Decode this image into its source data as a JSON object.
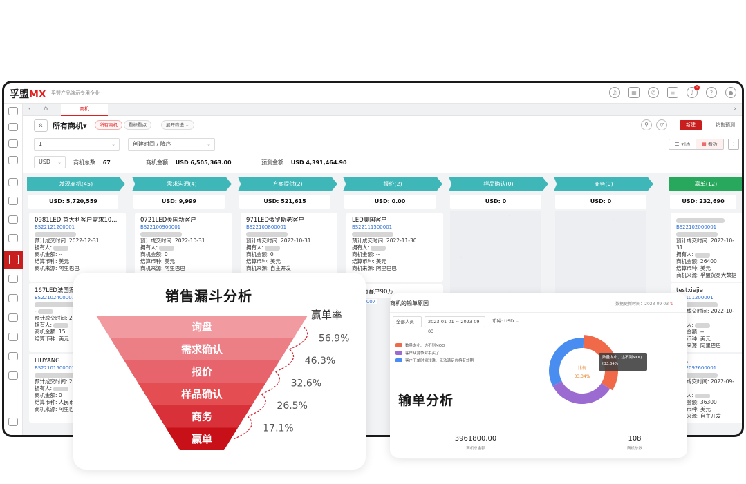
{
  "app": {
    "logo_text": "孚盟",
    "logo_mx": "MX",
    "subtitle": "孚盟产品演示专用企业",
    "tab_active": "商机"
  },
  "filters": {
    "title": "所有商机",
    "chips": [
      "所有商机",
      "重标重点"
    ],
    "expand_label": "展开筛选",
    "new_button": "新建",
    "forecast_button": "销售预测",
    "page_input": "1",
    "sort_select": "创建时间 / 降序",
    "currency_select": "USD",
    "view_list": "列表",
    "view_board": "看板",
    "summary": {
      "count_label": "商机总数:",
      "count_value": "67",
      "amount_label": "商机金额:",
      "amount_value": "USD 6,505,363.00",
      "forecast_label": "预测金额:",
      "forecast_value": "USD 4,391,464.90"
    }
  },
  "stages": [
    {
      "label": "发现商机(45)",
      "total": "USD: 5,720,559"
    },
    {
      "label": "需求沟通(4)",
      "total": "USD: 9,999"
    },
    {
      "label": "方案提供(2)",
      "total": "USD: 521,615"
    },
    {
      "label": "报价(2)",
      "total": "USD: 0.00"
    },
    {
      "label": "样品确认(0)",
      "total": "USD: 0"
    },
    {
      "label": "商务(0)",
      "total": "USD: 0"
    },
    {
      "label": "赢单(12)",
      "total": "USD: 232,690"
    }
  ],
  "cards": [
    {
      "title": "0981LED 意大利客户需求10...",
      "code": "BS22121200001",
      "l1": "预计成交时间:",
      "v1": "2022-12-31",
      "l2": "拥有人:",
      "v2": "",
      "l3": "商机金额:",
      "v3": "--",
      "l4": "结算币种:",
      "v4": "美元",
      "l5": "商机来源:",
      "v5": "阿里巴巴"
    },
    {
      "title": "0721LED英国新客户",
      "code": "BS22100900001",
      "l1": "预计成交时间:",
      "v1": "2022-10-31",
      "l2": "拥有人:",
      "v2": "",
      "l3": "商机金额:",
      "v3": "0",
      "l4": "结算币种:",
      "v4": "美元",
      "l5": "商机来源:",
      "v5": "阿里巴巴"
    },
    {
      "title": "971LED俄罗斯老客户",
      "code": "BS22100800001",
      "l1": "预计成交时间:",
      "v1": "2022-10-31",
      "l2": "拥有人:",
      "v2": "",
      "l3": "商机金额:",
      "v3": "0",
      "l4": "结算币种:",
      "v4": "美元",
      "l5": "商机来源:",
      "v5": "自主开发"
    },
    {
      "title": "LED美国客户",
      "code": "BS22111500001",
      "l1": "预计成交时间:",
      "v1": "2022-11-30",
      "l2": "拥有人:",
      "v2": "",
      "l3": "商机金额:",
      "v3": "--",
      "l4": "结算币种:",
      "v4": "美元",
      "l5": "商机来源:",
      "v5": "阿里巴巴"
    },
    {
      "title": "",
      "code": "BS22102000001",
      "l1": "预计成交时间:",
      "v1": "2022-10-31",
      "l2": "拥有人:",
      "v2": "",
      "l3": "商机金额:",
      "v3": "26400",
      "l4": "结算币种:",
      "v4": "美元",
      "l5": "商机来源:",
      "v5": "孚盟贸易大数据"
    },
    {
      "title": "167LED法国案",
      "code": "BS22102400001",
      "l1": "-",
      "v1": "",
      "l2": "预计成交时间:",
      "v2": "20",
      "l3": "拥有人:",
      "v3": "",
      "l4": "商机金额:",
      "v4": "15",
      "l5": "结算币种:",
      "v5": "美元"
    },
    {
      "title": "testxiejie",
      "code": "BS2101200001",
      "l1": "预计成交时间:",
      "v1": "2022-10-31",
      "l2": "拥有人:",
      "v2": "",
      "l3": "商机金额:",
      "v3": "--",
      "l4": "结算币种:",
      "v4": "美元",
      "l5": "商机来源:",
      "v5": "阿里巴巴"
    },
    {
      "title": "LIUYANG",
      "code": "BS22101500001",
      "l1": "预计成交时间:",
      "v1": "20",
      "l2": "拥有人:",
      "v2": "",
      "l3": "商机金额:",
      "v3": "0",
      "l4": "结算币种:",
      "v4": "人民币",
      "l5": "商机来源:",
      "v5": "阿里巴巴"
    },
    {
      "title": "商机",
      "code": "BS22092600001",
      "l1": "预计成交时间:",
      "v1": "2022-09-30",
      "l2": "拥有人:",
      "v2": "",
      "l3": "商机金额:",
      "v3": "36300",
      "l4": "结算币种:",
      "v4": "美元",
      "l5": "商机来源:",
      "v5": "自主开发"
    }
  ],
  "card_extra": {
    "title": "D越南客户90万",
    "code": "2900007"
  },
  "funnel": {
    "title": "销售漏斗分析",
    "rate_title": "赢单率",
    "stages": [
      "询盘",
      "需求确认",
      "报价",
      "样品确认",
      "商务",
      "赢单"
    ],
    "rates": [
      "56.9%",
      "46.3%",
      "32.6%",
      "26.5%",
      "17.1%"
    ],
    "colors": [
      "#f19aa0",
      "#ec7e86",
      "#e8646c",
      "#e44d52",
      "#d9313a",
      "#c81018"
    ]
  },
  "loss": {
    "header_title": "商机的输单原因",
    "header_time": "数据更新时间：2023-09-03",
    "ctl_people": "全部人员",
    "ctl_date": "2023-01-01 ~ 2023-09-03",
    "ctl_currency": "币种: USD",
    "legend": [
      {
        "label": "数量太小、达不到MOQ",
        "color": "#f06a4a"
      },
      {
        "label": "客户从竞争对手买了",
        "color": "#9b6bd1"
      },
      {
        "label": "客户下单时间较晚、无法满足价格有效期",
        "color": "#4a8df0"
      }
    ],
    "big_title": "输单分析",
    "donut_center_label": "比例",
    "donut_center_value": "33.34%",
    "tooltip_l1": "数量太小、达不到MOQ",
    "tooltip_l2": "(33.34%)",
    "kpi1_value": "3961800.00",
    "kpi1_label": "商机总金额",
    "kpi2_value": "108",
    "kpi2_label": "商机总数"
  },
  "chart_data": [
    {
      "type": "funnel",
      "categories": [
        "询盘",
        "需求确认",
        "报价",
        "样品确认",
        "商务",
        "赢单"
      ],
      "conversion_rates_percent": [
        56.9,
        46.3,
        32.6,
        26.5,
        17.1
      ],
      "title": "销售漏斗分析",
      "series_label": "赢单率"
    },
    {
      "type": "pie",
      "categories": [
        "数量太小、达不到MOQ",
        "客户从竞争对手买了",
        "客户下单时间较晚、无法满足价格有效期"
      ],
      "values": [
        33.34,
        33.33,
        33.33
      ],
      "title": "商机的输单原因",
      "donut": true
    }
  ]
}
